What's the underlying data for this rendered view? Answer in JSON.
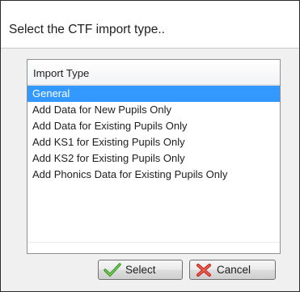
{
  "dialog": {
    "title": "Select the CTF import type.."
  },
  "list": {
    "header": "Import Type",
    "items": [
      {
        "label": "General",
        "selected": true
      },
      {
        "label": "Add Data for New Pupils Only",
        "selected": false
      },
      {
        "label": "Add Data for Existing Pupils Only",
        "selected": false
      },
      {
        "label": "Add KS1 for Existing Pupils Only",
        "selected": false
      },
      {
        "label": "Add KS2 for Existing Pupils Only",
        "selected": false
      },
      {
        "label": "Add Phonics Data for Existing Pupils Only",
        "selected": false
      }
    ]
  },
  "buttons": {
    "select": {
      "label": "Select",
      "icon": "checkmark-icon"
    },
    "cancel": {
      "label": "Cancel",
      "icon": "red-x-icon"
    }
  },
  "colors": {
    "selection": "#3399ff",
    "check": "#3fa82c",
    "cancel_x": "#e03a2d"
  }
}
